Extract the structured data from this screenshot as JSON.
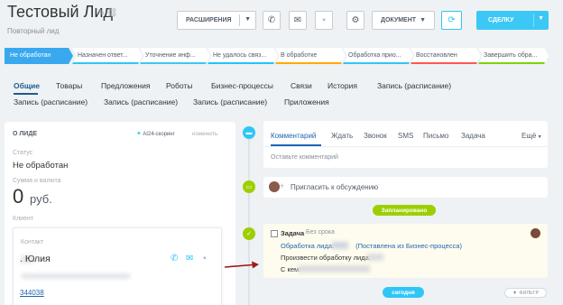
{
  "header": {
    "title": "Тестовый Лид",
    "subtitle": "Повторный лид",
    "pencil_icon": "pencil-icon",
    "link_icon": "link-icon"
  },
  "toolbar": {
    "extensions_label": "РАСШИРЕНИЯ",
    "document_label": "ДОКУМЕНТ",
    "deal_label": "СДЕЛКУ",
    "icons": [
      "phone-icon",
      "mail-icon",
      "chat-icon",
      "gear-icon",
      "convert-icon"
    ]
  },
  "stages": [
    {
      "label": "Не обработан",
      "color": "#39a8ef",
      "active": true
    },
    {
      "label": "Назначен ответ...",
      "color": "#2fc6f6"
    },
    {
      "label": "Уточнение инф...",
      "color": "#3bc8f5"
    },
    {
      "label": "Не удалось связ...",
      "color": "#1ec6fa"
    },
    {
      "label": "В обработке",
      "color": "#ffa900"
    },
    {
      "label": "Обработка прио...",
      "color": "#2fc6f6"
    },
    {
      "label": "Восстановлен",
      "color": "#ff5752"
    },
    {
      "label": "Завершить обра...",
      "color": "#7bd500"
    }
  ],
  "tabs_row1": [
    "Общие",
    "Товары",
    "Предложения",
    "Роботы",
    "Бизнес-процессы",
    "Связи",
    "История",
    "Запись (расписание)"
  ],
  "tabs_row2": [
    "Запись (расписание)",
    "Запись (расписание)",
    "Запись (расписание)",
    "Приложения"
  ],
  "lead_info": {
    "section_title": "О ЛИДЕ",
    "ai_scoring": "AI24-скоринг",
    "change_link": "изменить",
    "status_label": "Статус",
    "status_value": "Не обработан",
    "amount_label": "Сумма и валюта",
    "amount_value": "0",
    "currency": "руб.",
    "client_label": "Клиент",
    "contact_label": "Контакт",
    "contact_name": ". Юлия",
    "phone": "344038"
  },
  "timeline": {
    "comment_tabs": [
      "Комментарий",
      "Ждать",
      "Звонок",
      "SMS",
      "Письмо",
      "Задача",
      "Ещё"
    ],
    "comment_placeholder": "Оставьте комментарий",
    "invite_text": "Пригласить к обсуждению",
    "planned_label": "Запланировано",
    "task": {
      "title": "Задача",
      "deadline": "Без срока",
      "link_prefix": "Обработка лида:",
      "link_suffix": "(Поставлена из Бизнес-процесса)",
      "description": "Произвести обработку лида:",
      "from_label": "С кем:"
    },
    "today_label": "сегодня",
    "filter_label": "ФИЛЬТР"
  },
  "colors": {
    "accent": "#2fc6f6",
    "link": "#2067b0",
    "planned": "#9dcf00",
    "arrow": "#a01818"
  }
}
